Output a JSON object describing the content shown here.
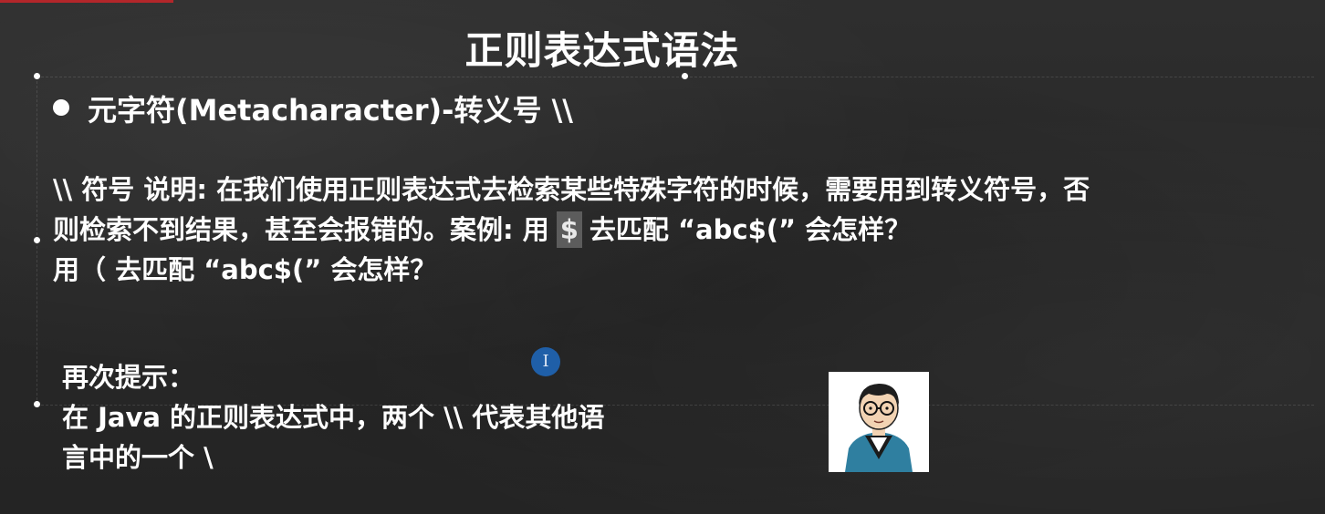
{
  "slide": {
    "title": "正则表达式语法",
    "bullet": "元字符(Metacharacter)-转义号 \\\\",
    "paragraph": {
      "line1": "\\\\ 符号 说明: 在我们使用正则表达式去检索某些特殊字符的时候，需要用到转义符号，否",
      "line2_pre": "则检索不到结果，甚至会报错的。案例: 用",
      "line2_highlight": "$",
      "line2_post": "去匹配 “abc$(” 会怎样？",
      "line3": "用（ 去匹配 “abc$(” 会怎样？"
    },
    "tips": {
      "heading": "再次提示：",
      "line1": "在 Java 的正则表达式中，两个 \\\\ 代表其他语",
      "line2": "言中的一个 \\"
    },
    "cursor_glyph": "I"
  },
  "colors": {
    "background": "#2a2a2a",
    "text": "#ffffff",
    "highlight": "#5c5c5c",
    "cursor": "#1f5fa8",
    "accent_bar": "#b3262a"
  },
  "icons": {
    "bullet": "bullet-dot",
    "cursor": "text-cursor-icon",
    "avatar": "teacher-avatar-illustration"
  }
}
